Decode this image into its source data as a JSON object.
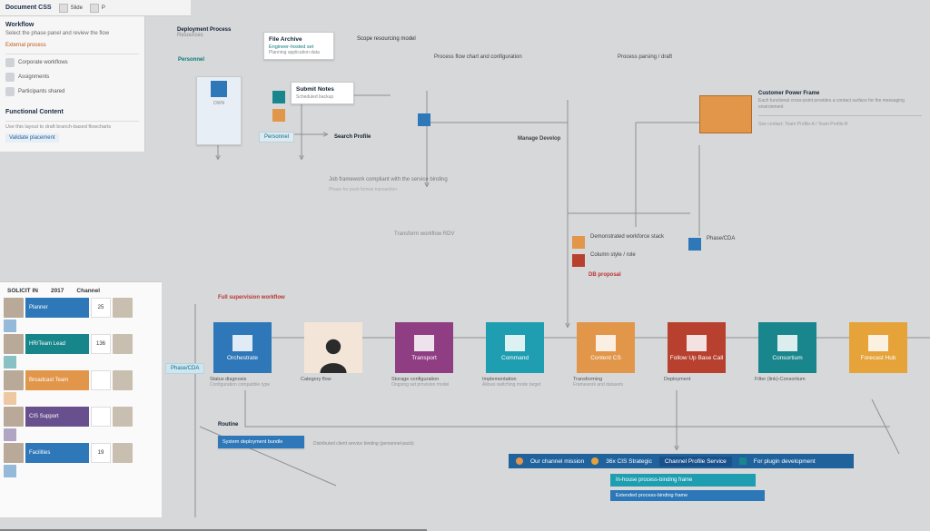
{
  "toolbar": {
    "title": "Document CSS",
    "btn1": "Slide",
    "btn2": "P"
  },
  "sidebar": {
    "heading": "Workflow",
    "subtitle": "Select the phase panel and review the flow",
    "link": "External process",
    "items": [
      {
        "label": "Corporate workflows"
      },
      {
        "label": "Assignments"
      },
      {
        "label": "Participants shared"
      }
    ],
    "section2": "Functional Content",
    "note": "Use this layout to draft branch-based flowcharts",
    "chip": "Validate placement"
  },
  "grid": {
    "h1": "SOLICIT IN",
    "h2": "2017",
    "h3": "Channel",
    "rows": [
      {
        "tile": "Planner",
        "color": "#2e77b8",
        "val": "25"
      },
      {
        "tile": "HR/Team Lead",
        "color": "#17868b",
        "val": "136"
      },
      {
        "tile": "Broadcast Team",
        "color": "#e1964a",
        "val": " "
      },
      {
        "tile": "CIS Support",
        "color": "#684f8e",
        "val": " "
      },
      {
        "tile": "Facilities",
        "color": "#2e77b8",
        "val": "19"
      }
    ]
  },
  "diagram": {
    "phaseA": {
      "title": "Deployment Process",
      "line": "Resources"
    },
    "cardA": {
      "title": "File Archive",
      "sub": "Engineer-hosted set",
      "desc": "Planning application data"
    },
    "cardB": {
      "title": "Submit Notes",
      "sub": "Scheduled backup"
    },
    "lblPersist": "Personnel",
    "lblScope": "Scope resourcing model",
    "lblSearch": "Search Profile",
    "topLine1": "Process flow chart and configuration",
    "topLine2": "Process parsing / draft",
    "midNote": "Job framework compliant with the service binding",
    "midSub": "Phase for push format transaction",
    "photoTitle": "Customer Power Frame",
    "photoDesc": "Each functional cross-point provides a contact surface for the messaging environment",
    "photoFoot": "See contact: Team Profile-A / Team Profile-B",
    "devops": "Manage Develop",
    "flowHdr": "Transform workflow RDV",
    "tiles": [
      {
        "label": "Orchestrate",
        "color": "#2e77b8",
        "cap1": "Status diagnosis",
        "cap2": "Configuration compatible type"
      },
      {
        "label": "",
        "color": "#684f8e",
        "cap1": "Category flow",
        "cap2": "",
        "person": true
      },
      {
        "label": "Transport",
        "color": "#8f3e83",
        "cap1": "Storage configuration",
        "cap2": "Ongoing set provision model"
      },
      {
        "label": "Command",
        "color": "#1e9eb0",
        "cap1": "Implementation",
        "cap2": "Allows switching mode target"
      },
      {
        "label": "Content CS",
        "color": "#e1964a",
        "cap1": "Transforming",
        "cap2": "Framework and datasets"
      },
      {
        "label": "Follow Up Base Call",
        "color": "#b7412e",
        "cap1": "Deployment",
        "cap2": ""
      },
      {
        "label": "Consortium",
        "color": "#18868c",
        "cap1": "Filter (link)-Consortium",
        "cap2": ""
      },
      {
        "label": "Forecast Hub",
        "color": "#e5a33a",
        "cap1": "",
        "cap2": ""
      }
    ],
    "redTag": "Full supervision workflow",
    "sideTag": "Phase/CDA",
    "rowTag1": "Demonstrated workforce stack",
    "rowTag2": "Column style / role",
    "rowOrange": "DB proposal",
    "route": "Routine",
    "routeSub1": "System deployment bundle",
    "routeSub2": "Distributed client service binding (personnel-pack)",
    "status": {
      "item1": "Our channel mission",
      "item2": "36x CIS Strategic",
      "item3": "Channel Profile Service",
      "item4": "For plugin development"
    },
    "subbar1": "In-house process-binding frame",
    "subbar2": "Extended process-binding frame"
  }
}
